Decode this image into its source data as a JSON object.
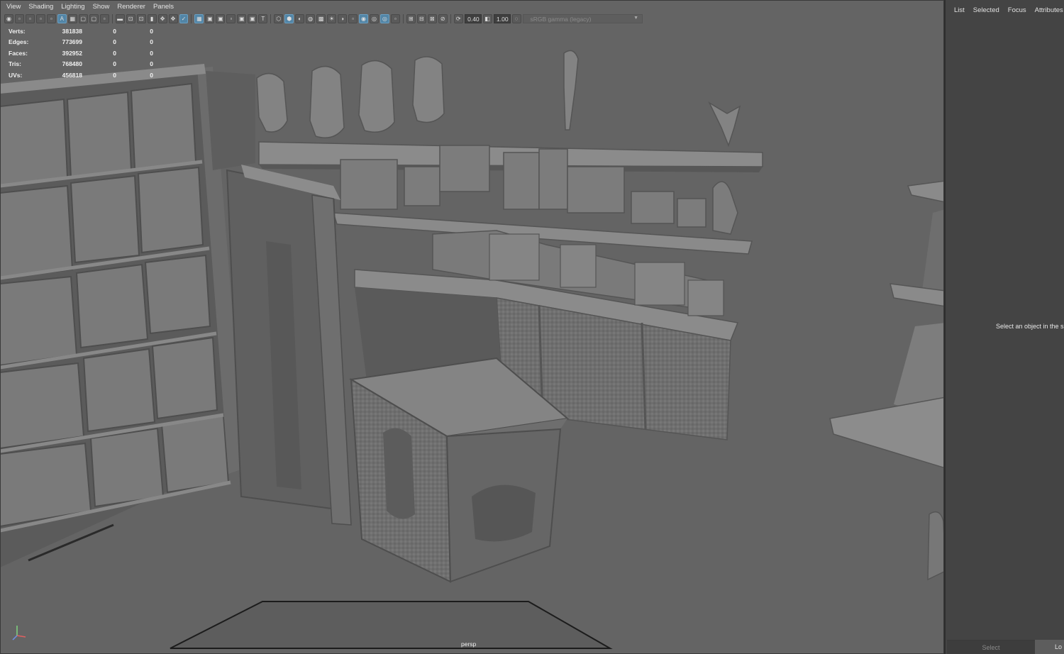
{
  "menus": [
    "View",
    "Shading",
    "Lighting",
    "Show",
    "Renderer",
    "Panels"
  ],
  "toolbar": {
    "exposure": "0.40",
    "gamma": "1.00",
    "color_space": "sRGB gamma (legacy)"
  },
  "hud": {
    "rows": [
      {
        "label": "Verts:",
        "values": [
          "381838",
          "0",
          "0"
        ]
      },
      {
        "label": "Edges:",
        "values": [
          "773699",
          "0",
          "0"
        ]
      },
      {
        "label": "Faces:",
        "values": [
          "392952",
          "0",
          "0"
        ]
      },
      {
        "label": "Tris:",
        "values": [
          "768480",
          "0",
          "0"
        ]
      },
      {
        "label": "UVs:",
        "values": [
          "456818",
          "0",
          "0"
        ]
      }
    ]
  },
  "camera_label": "persp",
  "panel": {
    "tabs": [
      "List",
      "Selected",
      "Focus",
      "Attributes"
    ],
    "message": "Select an object in the s",
    "select_button": "Select",
    "lo_button": "Lo"
  },
  "colors": {
    "viewport_bg": "#646464",
    "panel_bg": "#444444",
    "toolbar_active": "#5285a6"
  }
}
